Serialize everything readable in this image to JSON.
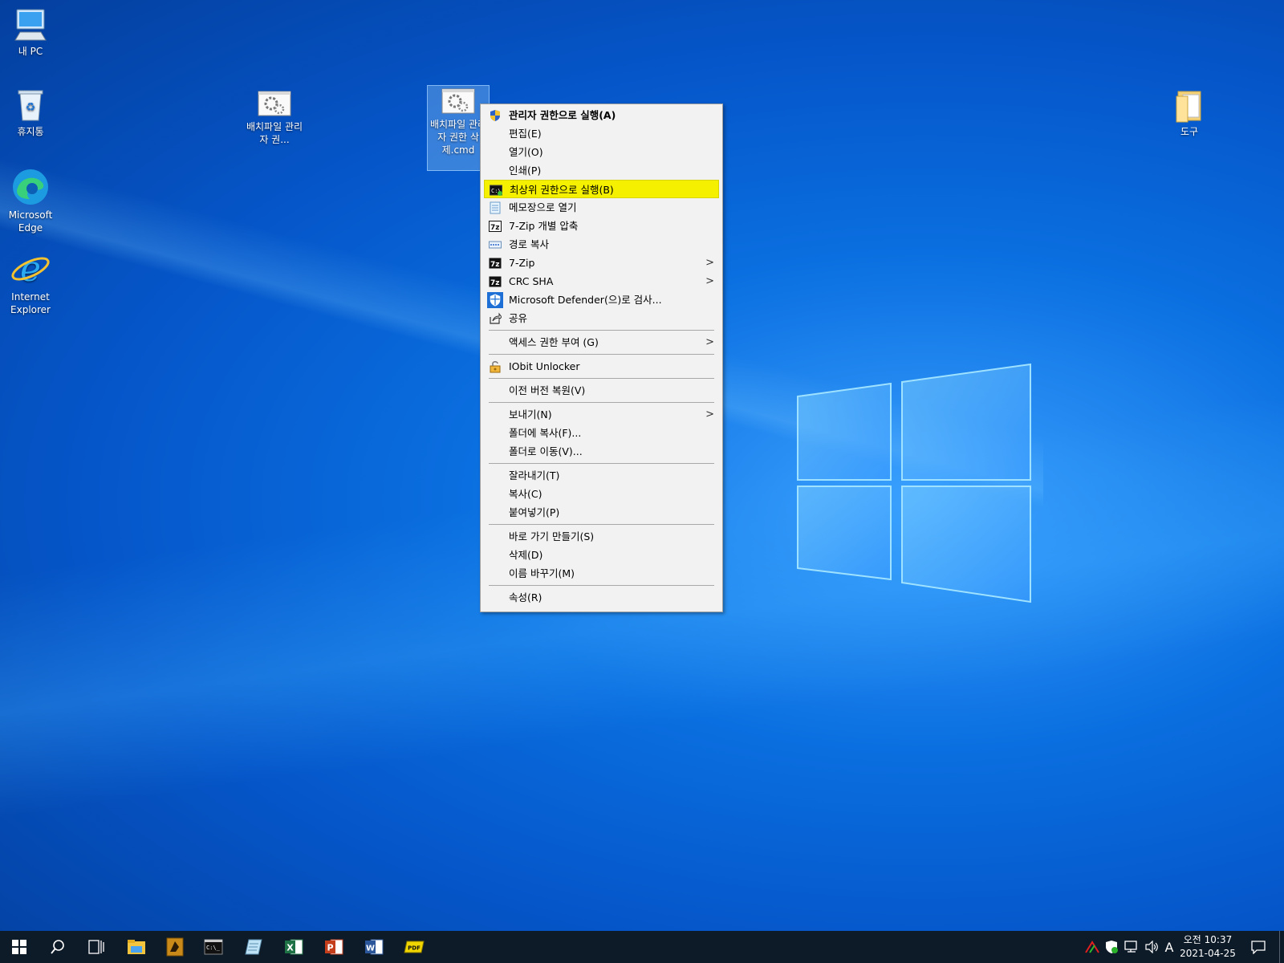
{
  "desktop": {
    "icons": [
      {
        "label": "내 PC"
      },
      {
        "label": "휴지통"
      },
      {
        "label": "Microsoft Edge"
      },
      {
        "label": "Internet Explorer"
      },
      {
        "label": "배치파일 관리자 권..."
      },
      {
        "label": "배치파일 관리자 권한 삭제.cmd"
      },
      {
        "label": "도구"
      }
    ]
  },
  "context_menu": {
    "items": [
      {
        "label": "관리자 권한으로 실행(A)",
        "icon": "uac-shield-icon"
      },
      {
        "label": "편집(E)"
      },
      {
        "label": "열기(O)"
      },
      {
        "label": "인쇄(P)"
      },
      {
        "label": "최상위 권한으로 실행(B)",
        "icon": "console-icon",
        "highlighted": true
      },
      {
        "label": "메모장으로 열기",
        "icon": "notepad-icon"
      },
      {
        "label": "7-Zip 개별 압축",
        "icon": "7zip-icon"
      },
      {
        "label": "경로 복사",
        "icon": "path-copy-icon"
      },
      {
        "label": "7-Zip",
        "icon": "7zip-icon",
        "submenu": true
      },
      {
        "label": "CRC SHA",
        "icon": "7zip-icon",
        "submenu": true
      },
      {
        "label": "Microsoft Defender(으)로 검사...",
        "icon": "defender-shield-icon"
      },
      {
        "label": "공유",
        "icon": "share-icon"
      },
      {
        "label": "액세스 권한 부여 (G)",
        "submenu": true
      },
      {
        "label": "IObit Unlocker",
        "icon": "unlocker-icon"
      },
      {
        "label": "이전 버전 복원(V)"
      },
      {
        "label": "보내기(N)",
        "submenu": true
      },
      {
        "label": "폴더에 복사(F)..."
      },
      {
        "label": "폴더로 이동(V)..."
      },
      {
        "label": "잘라내기(T)"
      },
      {
        "label": "복사(C)"
      },
      {
        "label": "붙여넣기(P)"
      },
      {
        "label": "바로 가기 만들기(S)"
      },
      {
        "label": "삭제(D)"
      },
      {
        "label": "이름 바꾸기(M)"
      },
      {
        "label": "속성(R)"
      }
    ],
    "highlight_color": "#f4f000"
  },
  "taskbar": {
    "ime_indicator": "A",
    "clock_time": "오전 10:37",
    "clock_date": "2021-04-25"
  }
}
